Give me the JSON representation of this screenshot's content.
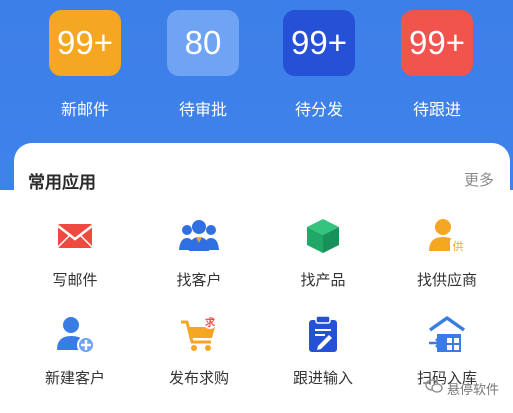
{
  "stats": [
    {
      "value": "99+",
      "label": "新邮件",
      "color": "#f5a623"
    },
    {
      "value": "80",
      "label": "待审批",
      "color": "#6ea4f3"
    },
    {
      "value": "99+",
      "label": "待分发",
      "color": "#2451d6"
    },
    {
      "value": "99+",
      "label": "待跟进",
      "color": "#f0544c"
    }
  ],
  "apps_section": {
    "title": "常用应用",
    "more": "更多",
    "items": [
      {
        "label": "写邮件",
        "icon": "envelope-icon"
      },
      {
        "label": "找客户",
        "icon": "customers-icon"
      },
      {
        "label": "找产品",
        "icon": "product-box-icon"
      },
      {
        "label": "找供应商",
        "icon": "supplier-icon"
      },
      {
        "label": "新建客户",
        "icon": "add-customer-icon"
      },
      {
        "label": "发布求购",
        "icon": "shopping-cart-icon"
      },
      {
        "label": "跟进输入",
        "icon": "clipboard-edit-icon"
      },
      {
        "label": "扫码入库",
        "icon": "warehouse-icon"
      }
    ]
  },
  "watermark": "悬停软件"
}
